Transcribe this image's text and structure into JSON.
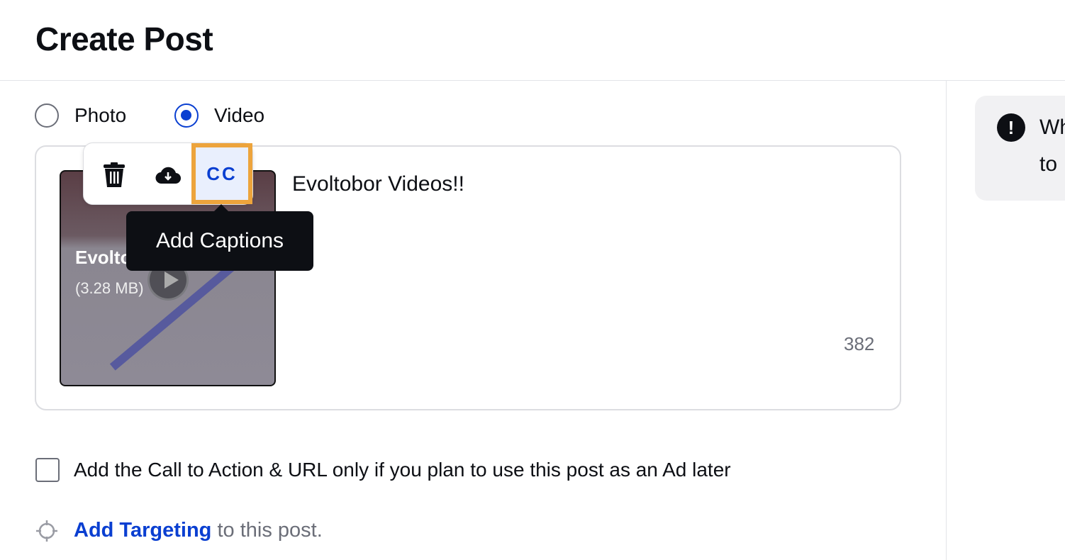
{
  "header": {
    "title": "Create Post"
  },
  "media_type": {
    "options": [
      {
        "label": "Photo",
        "selected": false
      },
      {
        "label": "Video",
        "selected": true
      }
    ]
  },
  "post": {
    "text": "Evoltobor Videos!!",
    "char_count": "382",
    "video": {
      "name": "Evoltobor Videos!!",
      "size": "(3.28 MB)"
    },
    "toolbar": {
      "icons": [
        "trash-icon",
        "cloud-download-icon",
        "closed-captions-icon"
      ],
      "cc_label": "CC",
      "tooltip": "Add Captions"
    }
  },
  "cta": {
    "label": "Add the Call to Action & URL only if you plan to use this post as an Ad later",
    "checked": false
  },
  "targeting": {
    "link": "Add Targeting",
    "suffix": "to this post."
  },
  "notice": {
    "line1": "Wh",
    "line2": "to"
  },
  "colors": {
    "accent": "#0a3fd1",
    "highlight": "#eda43c",
    "tooltip_bg": "#0d0f14"
  }
}
